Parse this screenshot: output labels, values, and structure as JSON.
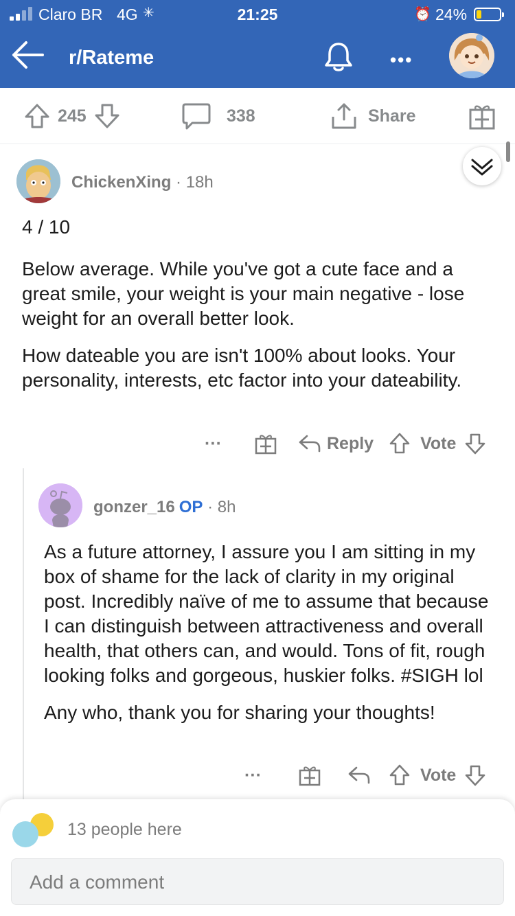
{
  "status_bar": {
    "carrier": "Claro BR",
    "network": "4G",
    "time": "21:25",
    "battery": "24%",
    "battery_level": 0.24
  },
  "header": {
    "subreddit": "r/Rateme",
    "icons": [
      "back-arrow-icon",
      "bell-icon",
      "more-icon",
      "user-avatar"
    ]
  },
  "post_actions": {
    "upvotes": "245",
    "comments": "338",
    "share": "Share"
  },
  "comments": [
    {
      "author": "ChickenXing",
      "time": "18h",
      "rating": "4 / 10",
      "paragraphs": [
        "Below average.  While you've got a cute face and a great smile, your weight is your main negative - lose weight for an overall better look.",
        "How dateable you are isn't 100% about looks. Your personality, interests, etc factor into your dateability."
      ],
      "actions": {
        "more": "···",
        "reply": "Reply",
        "vote": "Vote"
      }
    },
    {
      "author": "gonzer_16",
      "badge": "OP",
      "time": "8h",
      "paragraphs": [
        "As a future attorney, I assure you I am sitting in my box of shame for the lack of clarity in my original post. Incredibly naïve of me to assume that because I can distinguish between attractiveness and overall health, that others can, and would. Tons of fit, rough looking folks and gorgeous, huskier folks. #SIGH lol",
        "Any who, thank you for sharing your thoughts!"
      ],
      "actions": {
        "more": "···",
        "vote": "Vote"
      }
    }
  ],
  "bottom_bar": {
    "people_here": "13 people here",
    "comment_placeholder": "Add a comment"
  },
  "colors": {
    "header_bg": "#3366b7",
    "op_badge": "#2f6fd4",
    "meta_text": "#7c7c7c"
  }
}
